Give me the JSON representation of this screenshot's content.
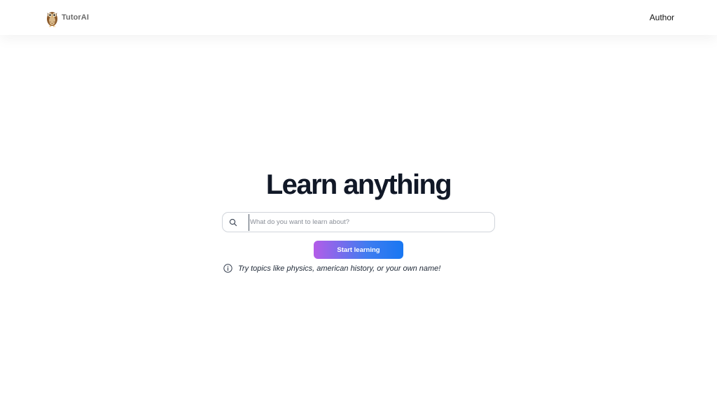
{
  "header": {
    "brand_name": "TutorAI",
    "nav_author": "Author"
  },
  "main": {
    "title": "Learn anything",
    "search": {
      "placeholder": "What do you want to learn about?",
      "value": ""
    },
    "start_button": "Start learning",
    "hint": "Try topics like physics, american history, or your own name!"
  },
  "colors": {
    "button_gradient_start": "#b45ce8",
    "button_gradient_end": "#1877f2",
    "title": "#111827"
  },
  "icons": [
    "owl-logo-icon",
    "search-icon",
    "info-icon"
  ]
}
